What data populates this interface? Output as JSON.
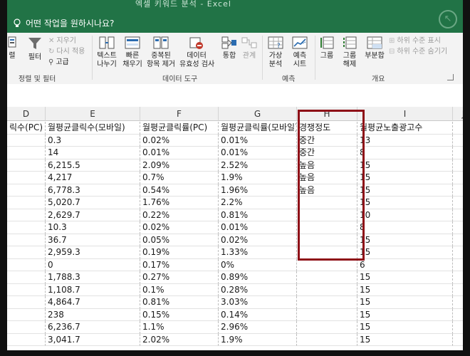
{
  "window": {
    "title": "엑셀 키워드 분석 - Excel"
  },
  "tell_me": {
    "placeholder": "어떤 작업을 원하시나요?"
  },
  "ribbon": {
    "groups": [
      {
        "label": "정렬 및 필터"
      },
      {
        "label": "데이터 도구"
      },
      {
        "label": "예측"
      },
      {
        "label": "개요"
      }
    ],
    "sort_partial": "렬",
    "filter": "필터",
    "reapply": "지우기",
    "reapply2": "다시 적용",
    "advanced": "고급",
    "text_to_columns": "텍스트\n나누기",
    "flash_fill": "빠른\n채우기",
    "remove_duplicates": "중복된\n항목 제거",
    "data_validation": "데이터\n유효성 검사",
    "consolidate": "통합",
    "relationships": "관계",
    "what_if": "가상\n분석",
    "forecast_sheet": "예측\n시트",
    "group": "그룹",
    "ungroup": "그룹\n해제",
    "subtotal": "부분합",
    "show_detail": "하위 수준 표시",
    "hide_detail": "하위 수준 숨기기"
  },
  "columns": [
    {
      "letter": "D"
    },
    {
      "letter": "E"
    },
    {
      "letter": "F"
    },
    {
      "letter": "G"
    },
    {
      "letter": "H"
    },
    {
      "letter": "I"
    },
    {
      "letter": "J"
    }
  ],
  "header_row": [
    "릭수(PC)",
    "월평균클릭수(모바일)",
    "월평균클릭률(PC)",
    "월평균클릭률(모바일)",
    "경쟁정도",
    "월평균노출광고수",
    ""
  ],
  "rows": [
    [
      "",
      "0.3",
      "0.02%",
      "0.01%",
      "중간",
      "13",
      ""
    ],
    [
      "",
      "14",
      "0.01%",
      "0.01%",
      "중간",
      "8",
      ""
    ],
    [
      "",
      "6,215.5",
      "2.09%",
      "2.52%",
      "높음",
      "15",
      ""
    ],
    [
      "",
      "4,217",
      "0.7%",
      "1.9%",
      "높음",
      "15",
      ""
    ],
    [
      "",
      "6,778.3",
      "0.54%",
      "1.96%",
      "높음",
      "15",
      ""
    ],
    [
      "",
      "5,020.7",
      "1.76%",
      "2.2%",
      "",
      "15",
      ""
    ],
    [
      "",
      "2,629.7",
      "0.22%",
      "0.81%",
      "",
      "10",
      ""
    ],
    [
      "",
      "10.3",
      "0.02%",
      "0.01%",
      "",
      "8",
      ""
    ],
    [
      "",
      "36.7",
      "0.05%",
      "0.02%",
      "",
      "15",
      ""
    ],
    [
      "",
      "2,959.3",
      "0.19%",
      "1.33%",
      "",
      "15",
      ""
    ],
    [
      "",
      "0",
      "0.17%",
      "0%",
      "",
      "6",
      ""
    ],
    [
      "",
      "1,788.3",
      "0.27%",
      "0.89%",
      "",
      "15",
      ""
    ],
    [
      "",
      "1,108.7",
      "0.1%",
      "0.28%",
      "",
      "15",
      ""
    ],
    [
      "",
      "4,864.7",
      "0.81%",
      "3.03%",
      "",
      "15",
      ""
    ],
    [
      "",
      "238",
      "0.15%",
      "0.14%",
      "",
      "15",
      ""
    ],
    [
      "",
      "6,236.7",
      "1.1%",
      "2.96%",
      "",
      "15",
      ""
    ],
    [
      "",
      "3,041.7",
      "2.02%",
      "1.9%",
      "",
      "15",
      ""
    ]
  ],
  "colors": {
    "excel_green": "#217346",
    "highlight_red": "#8e0f17"
  }
}
